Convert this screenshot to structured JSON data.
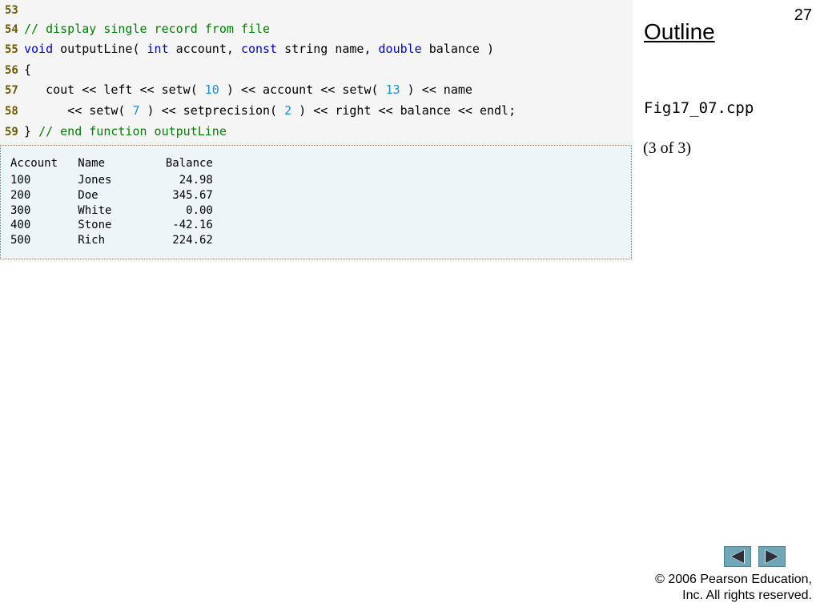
{
  "slide": {
    "page_number": "27",
    "outline_title": "Outline",
    "file_name": "Fig17_07.cpp",
    "page_of": "(3 of 3)",
    "copyright_line1": "© 2006 Pearson Education,",
    "copyright_line2": "Inc.  All rights reserved."
  },
  "code": {
    "lines": [
      {
        "number": "53",
        "tokens": []
      },
      {
        "number": "54",
        "tokens": [
          {
            "t": "comment",
            "v": "// display single record from file"
          }
        ]
      },
      {
        "number": "55",
        "tokens": [
          {
            "t": "kw",
            "v": "void"
          },
          {
            "t": "plain",
            "v": " outputLine( "
          },
          {
            "t": "kw",
            "v": "int"
          },
          {
            "t": "plain",
            "v": " account, "
          },
          {
            "t": "kw",
            "v": "const"
          },
          {
            "t": "plain",
            "v": " string name, "
          },
          {
            "t": "kw",
            "v": "double"
          },
          {
            "t": "plain",
            "v": " balance )"
          }
        ]
      },
      {
        "number": "56",
        "tokens": [
          {
            "t": "plain",
            "v": "{"
          }
        ]
      },
      {
        "number": "57",
        "tokens": [
          {
            "t": "plain",
            "v": "   cout << left << setw( "
          },
          {
            "t": "num",
            "v": "10"
          },
          {
            "t": "plain",
            "v": " ) << account << setw( "
          },
          {
            "t": "num",
            "v": "13"
          },
          {
            "t": "plain",
            "v": " ) << name"
          }
        ]
      },
      {
        "number": "58",
        "tokens": [
          {
            "t": "plain",
            "v": "      << setw( "
          },
          {
            "t": "num",
            "v": "7"
          },
          {
            "t": "plain",
            "v": " ) << setprecision( "
          },
          {
            "t": "num",
            "v": "2"
          },
          {
            "t": "plain",
            "v": " ) << right << balance << endl;"
          }
        ]
      },
      {
        "number": "59",
        "tokens": [
          {
            "t": "plain",
            "v": "} "
          },
          {
            "t": "comment",
            "v": "// end function outputLine"
          }
        ]
      }
    ]
  },
  "output": {
    "header": "Account   Name         Balance",
    "rows": [
      "100       Jones          24.98",
      "200       Doe           345.67",
      "300       White           0.00",
      "400       Stone         -42.16",
      "500       Rich          224.62"
    ]
  },
  "navigation": {
    "prev_icon": "triangle-left-icon",
    "next_icon": "triangle-right-icon",
    "button_color": "#6fa7b8"
  }
}
